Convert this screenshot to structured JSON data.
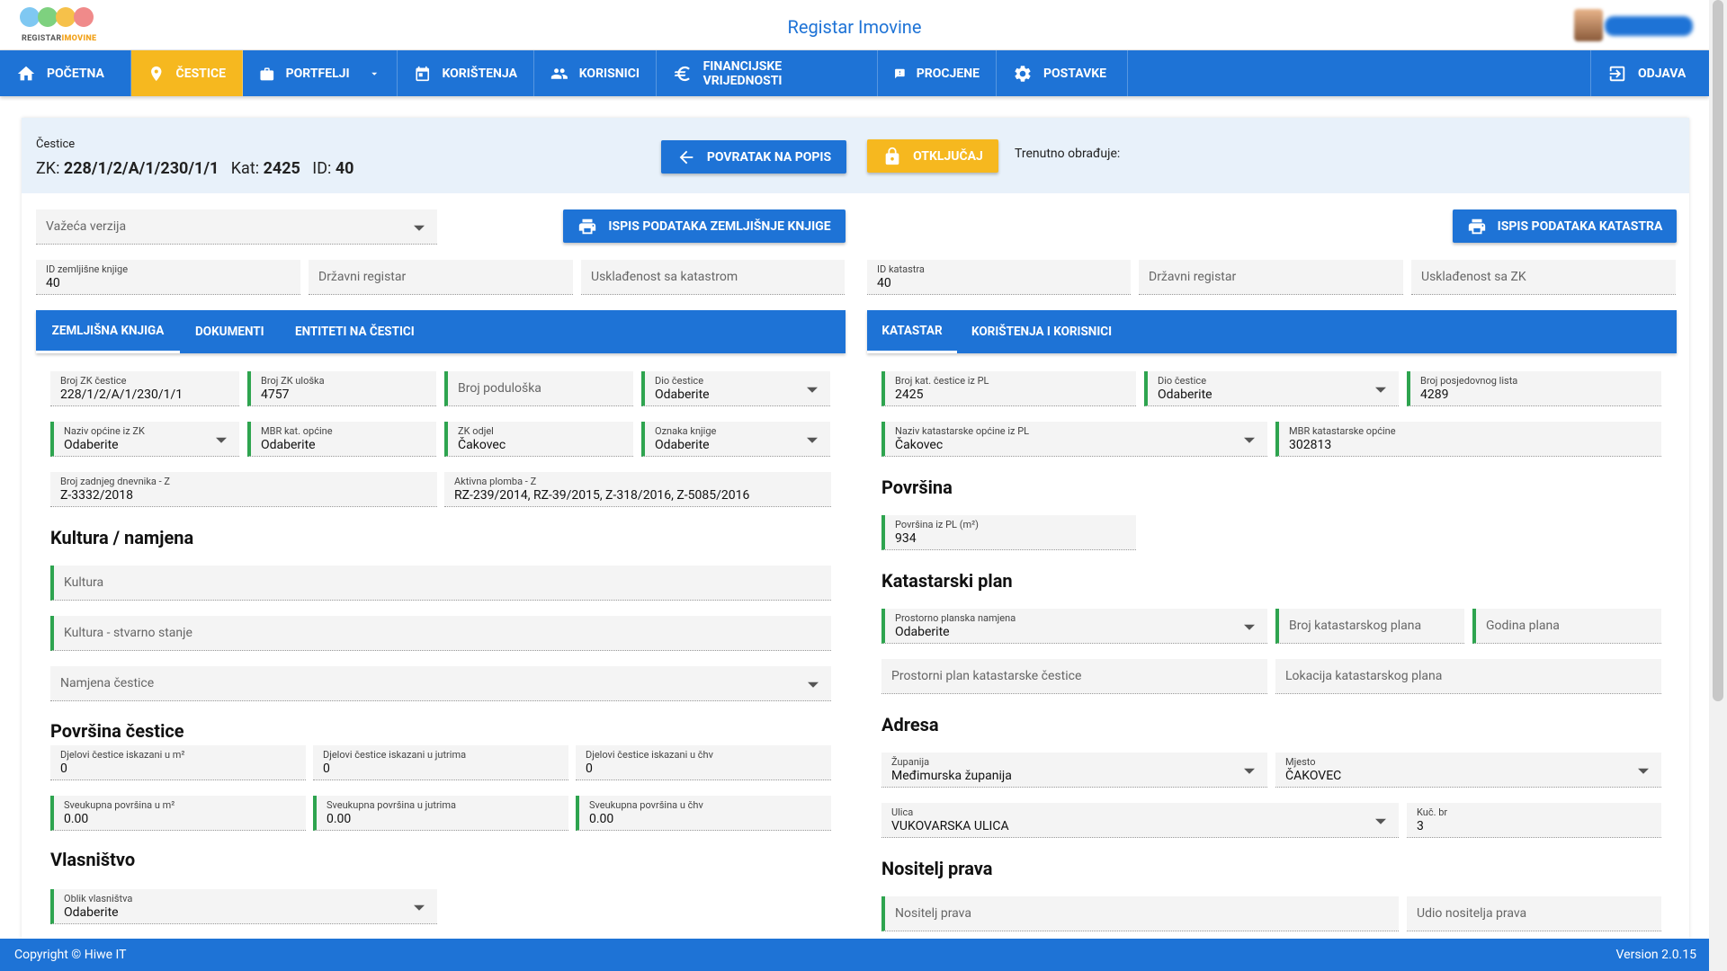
{
  "app": {
    "title": "Registar Imovine",
    "logo_text_a": "REGISTAR",
    "logo_text_b": "IMOVINE",
    "colors": {
      "primary": "#1e73d6",
      "accent": "#f6b81f",
      "required": "#2ea44f"
    }
  },
  "nav": {
    "items": [
      {
        "label": "POČETNA",
        "icon": "home-icon"
      },
      {
        "label": "ČESTICE",
        "icon": "location-pin-icon",
        "active": true
      },
      {
        "label": "PORTFELJI",
        "icon": "briefcase-icon",
        "dropdown": true
      },
      {
        "label": "KORIŠTENJA",
        "icon": "calendar-icon"
      },
      {
        "label": "KORISNICI",
        "icon": "users-icon"
      },
      {
        "label": "FINANCIJSKE VRIJEDNOSTI",
        "icon": "euro-icon"
      },
      {
        "label": "PROCJENE",
        "icon": "feedback-icon"
      },
      {
        "label": "POSTAVKE",
        "icon": "gear-icon"
      }
    ],
    "logout": {
      "label": "ODJAVA",
      "icon": "logout-icon"
    }
  },
  "header": {
    "label": "Čestice",
    "zk_prefix": "ZK:",
    "zk_value": "228/1/2/A/1/230/1/1",
    "kat_prefix": "Kat:",
    "kat_value": "2425",
    "id_prefix": "ID:",
    "id_value": "40",
    "back_button": "POVRATAK NA POPIS",
    "unlock_button": "OTKLJUČAJ",
    "editing_label": "Trenutno obrađuje:"
  },
  "version_select": {
    "placeholder": "Važeća verzija"
  },
  "print_zk_button": "ISPIS PODATAKA ZEMLJIŠNJE KNJIGE",
  "print_kat_button": "ISPIS PODATAKA KATASTRA",
  "left_top": {
    "id_zk_label": "ID zemljišne knjige",
    "id_zk_value": "40",
    "drzavni_registar": "Državni registar",
    "uskladenost": "Usklađenost sa katastrom"
  },
  "right_top": {
    "id_kat_label": "ID katastra",
    "id_kat_value": "40",
    "drzavni_registar": "Državni registar",
    "uskladenost": "Usklađenost sa ZK"
  },
  "left_tabs": [
    "ZEMLJIŠNA KNJIGA",
    "DOKUMENTI",
    "ENTITETI NA ČESTICI"
  ],
  "right_tabs": [
    "KATASTAR",
    "KORIŠTENJA I KORISNICI"
  ],
  "zk": {
    "broj_zk_cestice": {
      "label": "Broj ZK čestice",
      "value": "228/1/2/A/1/230/1/1"
    },
    "broj_zk_uloska": {
      "label": "Broj ZK uloška",
      "value": "4757"
    },
    "broj_poduloska": "Broj poduloška",
    "dio_cestice": {
      "label": "Dio čestice",
      "value": "Odaberite"
    },
    "naziv_opcine": {
      "label": "Naziv općine iz ZK",
      "value": "Odaberite"
    },
    "mbr_kat_opcine": {
      "label": "MBR kat. općine",
      "value": "Odaberite"
    },
    "zk_odjel": {
      "label": "ZK odjel",
      "value": "Čakovec"
    },
    "oznaka_knjige": {
      "label": "Oznaka knjige",
      "value": "Odaberite"
    },
    "broj_dnevnika": {
      "label": "Broj zadnjeg dnevnika - Z",
      "value": "Z-3332/2018"
    },
    "aktivna_plomba": {
      "label": "Aktivna plomba - Z",
      "value": "RZ-239/2014, RZ-39/2015, Z-318/2016, Z-5085/2016"
    }
  },
  "kultura": {
    "heading": "Kultura / namjena",
    "kultura": "Kultura",
    "kultura_stvarno": "Kultura - stvarno stanje",
    "namjena": "Namjena čestice"
  },
  "povrsina_cestice": {
    "heading": "Površina čestice",
    "m2": {
      "label": "Djelovi čestice iskazani u m²",
      "value": "0"
    },
    "jutra": {
      "label": "Djelovi čestice iskazani u jutrima",
      "value": "0"
    },
    "chv": {
      "label": "Djelovi čestice iskazani u čhv",
      "value": "0"
    },
    "uk_m2": {
      "label": "Sveukupna površina u m²",
      "value": "0.00"
    },
    "uk_jutra": {
      "label": "Sveukupna površina u jutrima",
      "value": "0.00"
    },
    "uk_chv": {
      "label": "Sveukupna površina u čhv",
      "value": "0.00"
    }
  },
  "vlasnistvo": {
    "heading": "Vlasništvo",
    "oblik": {
      "label": "Oblik vlasništva",
      "value": "Odaberite"
    }
  },
  "kat": {
    "broj_kat_cestice": {
      "label": "Broj kat. čestice iz PL",
      "value": "2425"
    },
    "dio_cestice": {
      "label": "Dio čestice",
      "value": "Odaberite"
    },
    "broj_posjedovnog": {
      "label": "Broj posjedovnog lista",
      "value": "4289"
    },
    "naziv_kat_opcine": {
      "label": "Naziv katastarske općine iz PL",
      "value": "Čakovec"
    },
    "mbr_kat_opcine": {
      "label": "MBR katastarske općine",
      "value": "302813"
    }
  },
  "povrsina": {
    "heading": "Površina",
    "pl": {
      "label": "Površina iz PL (m²)",
      "value": "934"
    }
  },
  "kat_plan": {
    "heading": "Katastarski plan",
    "namjena": {
      "label": "Prostorno planska namjena",
      "value": "Odaberite"
    },
    "broj_plana": "Broj katastarskog plana",
    "godina": "Godina plana",
    "prostorni_plan": "Prostorni plan katastarske čestice",
    "lokacija": "Lokacija katastarskog plana"
  },
  "adresa": {
    "heading": "Adresa",
    "zupanija": {
      "label": "Županija",
      "value": "Međimurska županija"
    },
    "mjesto": {
      "label": "Mjesto",
      "value": "ČAKOVEC"
    },
    "ulica": {
      "label": "Ulica",
      "value": "VUKOVARSKA ULICA"
    },
    "kuc_br": {
      "label": "Kuč. br",
      "value": "3"
    }
  },
  "nositelj": {
    "heading": "Nositelj prava",
    "nositelj": "Nositelj prava",
    "udio": "Udio nositelja prava"
  },
  "footer": {
    "copyright": "Copyright © Hiwe IT",
    "version": "Version 2.0.15"
  }
}
